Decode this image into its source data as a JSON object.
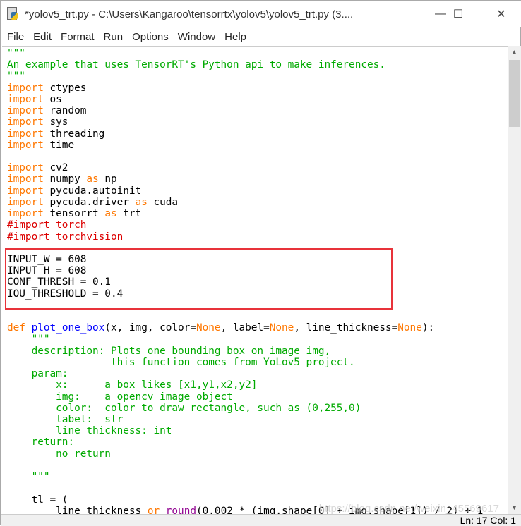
{
  "window": {
    "title": "*yolov5_trt.py - C:\\Users\\Kangaroo\\tensorrtx\\yolov5\\yolov5_trt.py (3....",
    "minimize": "—",
    "maximize": "☐",
    "close": "✕"
  },
  "menu": [
    "File",
    "Edit",
    "Format",
    "Run",
    "Options",
    "Window",
    "Help"
  ],
  "code_lines": [
    [
      [
        "\"\"\"",
        "s"
      ]
    ],
    [
      [
        "An example that uses TensorRT's Python api to make inferences.",
        "s"
      ]
    ],
    [
      [
        "\"\"\"",
        "s"
      ]
    ],
    [
      [
        "import",
        "k"
      ],
      [
        " ctypes",
        ""
      ]
    ],
    [
      [
        "import",
        "k"
      ],
      [
        " os",
        ""
      ]
    ],
    [
      [
        "import",
        "k"
      ],
      [
        " random",
        ""
      ]
    ],
    [
      [
        "import",
        "k"
      ],
      [
        " sys",
        ""
      ]
    ],
    [
      [
        "import",
        "k"
      ],
      [
        " threading",
        ""
      ]
    ],
    [
      [
        "import",
        "k"
      ],
      [
        " time",
        ""
      ]
    ],
    [],
    [
      [
        "import",
        "k"
      ],
      [
        " cv2",
        ""
      ]
    ],
    [
      [
        "import",
        "k"
      ],
      [
        " numpy ",
        ""
      ],
      [
        "as",
        "k"
      ],
      [
        " np",
        ""
      ]
    ],
    [
      [
        "import",
        "k"
      ],
      [
        " pycuda.autoinit",
        ""
      ]
    ],
    [
      [
        "import",
        "k"
      ],
      [
        " pycuda.driver ",
        ""
      ],
      [
        "as",
        "k"
      ],
      [
        " cuda",
        ""
      ]
    ],
    [
      [
        "import",
        "k"
      ],
      [
        " tensorrt ",
        ""
      ],
      [
        "as",
        "k"
      ],
      [
        " trt",
        ""
      ]
    ],
    [
      [
        "#import torch",
        "c"
      ]
    ],
    [
      [
        "#import torchvision",
        "c"
      ]
    ],
    [],
    [
      [
        "INPUT_W = 608",
        ""
      ]
    ],
    [
      [
        "INPUT_H = 608",
        ""
      ]
    ],
    [
      [
        "CONF_THRESH = 0.1",
        ""
      ]
    ],
    [
      [
        "IOU_THRESHOLD = 0.4",
        ""
      ]
    ],
    [],
    [],
    [
      [
        "def",
        "k"
      ],
      [
        " ",
        ""
      ],
      [
        "plot_one_box",
        "d"
      ],
      [
        "(x, img, color=",
        ""
      ],
      [
        "None",
        "k"
      ],
      [
        ", label=",
        ""
      ],
      [
        "None",
        "k"
      ],
      [
        ", line_thickness=",
        ""
      ],
      [
        "None",
        "k"
      ],
      [
        "):",
        ""
      ]
    ],
    [
      [
        "    \"\"\"",
        "s"
      ]
    ],
    [
      [
        "    description: Plots one bounding box on image img,",
        "s"
      ]
    ],
    [
      [
        "                 this function comes from YoLov5 project.",
        "s"
      ]
    ],
    [
      [
        "    param:",
        "s"
      ]
    ],
    [
      [
        "        x:      a box likes [x1,y1,x2,y2]",
        "s"
      ]
    ],
    [
      [
        "        img:    a opencv image object",
        "s"
      ]
    ],
    [
      [
        "        color:  color to draw rectangle, such as (0,255,0)",
        "s"
      ]
    ],
    [
      [
        "        label:  str",
        "s"
      ]
    ],
    [
      [
        "        line_thickness: int",
        "s"
      ]
    ],
    [
      [
        "    return:",
        "s"
      ]
    ],
    [
      [
        "        no return",
        "s"
      ]
    ],
    [],
    [
      [
        "    \"\"\"",
        "s"
      ]
    ],
    [],
    [
      [
        "    tl = (",
        ""
      ]
    ],
    [
      [
        "        line_thickness ",
        ""
      ],
      [
        "or",
        "k"
      ],
      [
        " ",
        ""
      ],
      [
        "round",
        "b"
      ],
      [
        "(0.002 * (img.shape[0] + img.shape[1]) / 2) + 1",
        ""
      ]
    ]
  ],
  "status": {
    "line_col": "Ln: 17  Col: 1"
  },
  "watermark": "https://blog.csdn.net/weixin_45569617",
  "colors": {
    "keyword": "#ff7700",
    "builtin": "#900090",
    "string": "#00aa00",
    "comment": "#dd0000",
    "definition": "#0000ff",
    "highlight_box": "#e8333a"
  }
}
